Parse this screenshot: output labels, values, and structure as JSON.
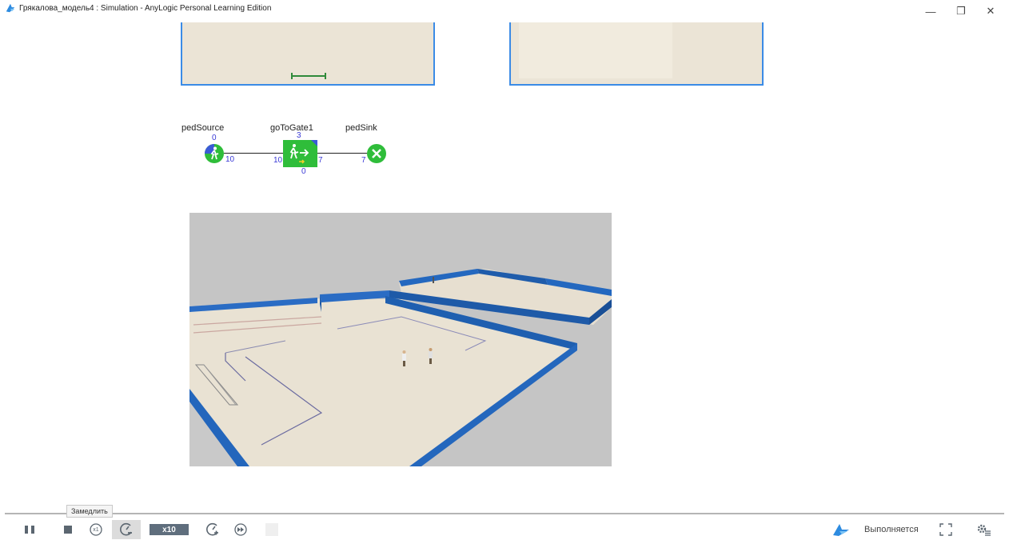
{
  "window": {
    "title": "Грякалова_модель4 : Simulation - AnyLogic Personal Learning Edition",
    "minimize": "—",
    "maximize": "❐",
    "close": "✕"
  },
  "flowchart": {
    "blocks": [
      {
        "id": "source",
        "label": "pedSource",
        "count_top": "0",
        "count_out": "10"
      },
      {
        "id": "gate",
        "label": "goToGate1",
        "count_top": "3",
        "count_in": "10",
        "count_out": "7",
        "count_bottom": "0"
      },
      {
        "id": "sink",
        "label": "pedSink",
        "count_in": "7"
      }
    ]
  },
  "toolbar": {
    "tooltip": "Замедлить",
    "speed_label": "x10",
    "realtime_label": "x1",
    "status": "Выполняется"
  },
  "colors": {
    "accent": "#3b8be6",
    "wall": "#1f64b4",
    "node_green": "#2fbd3a",
    "floor": "#ebe4d6"
  }
}
